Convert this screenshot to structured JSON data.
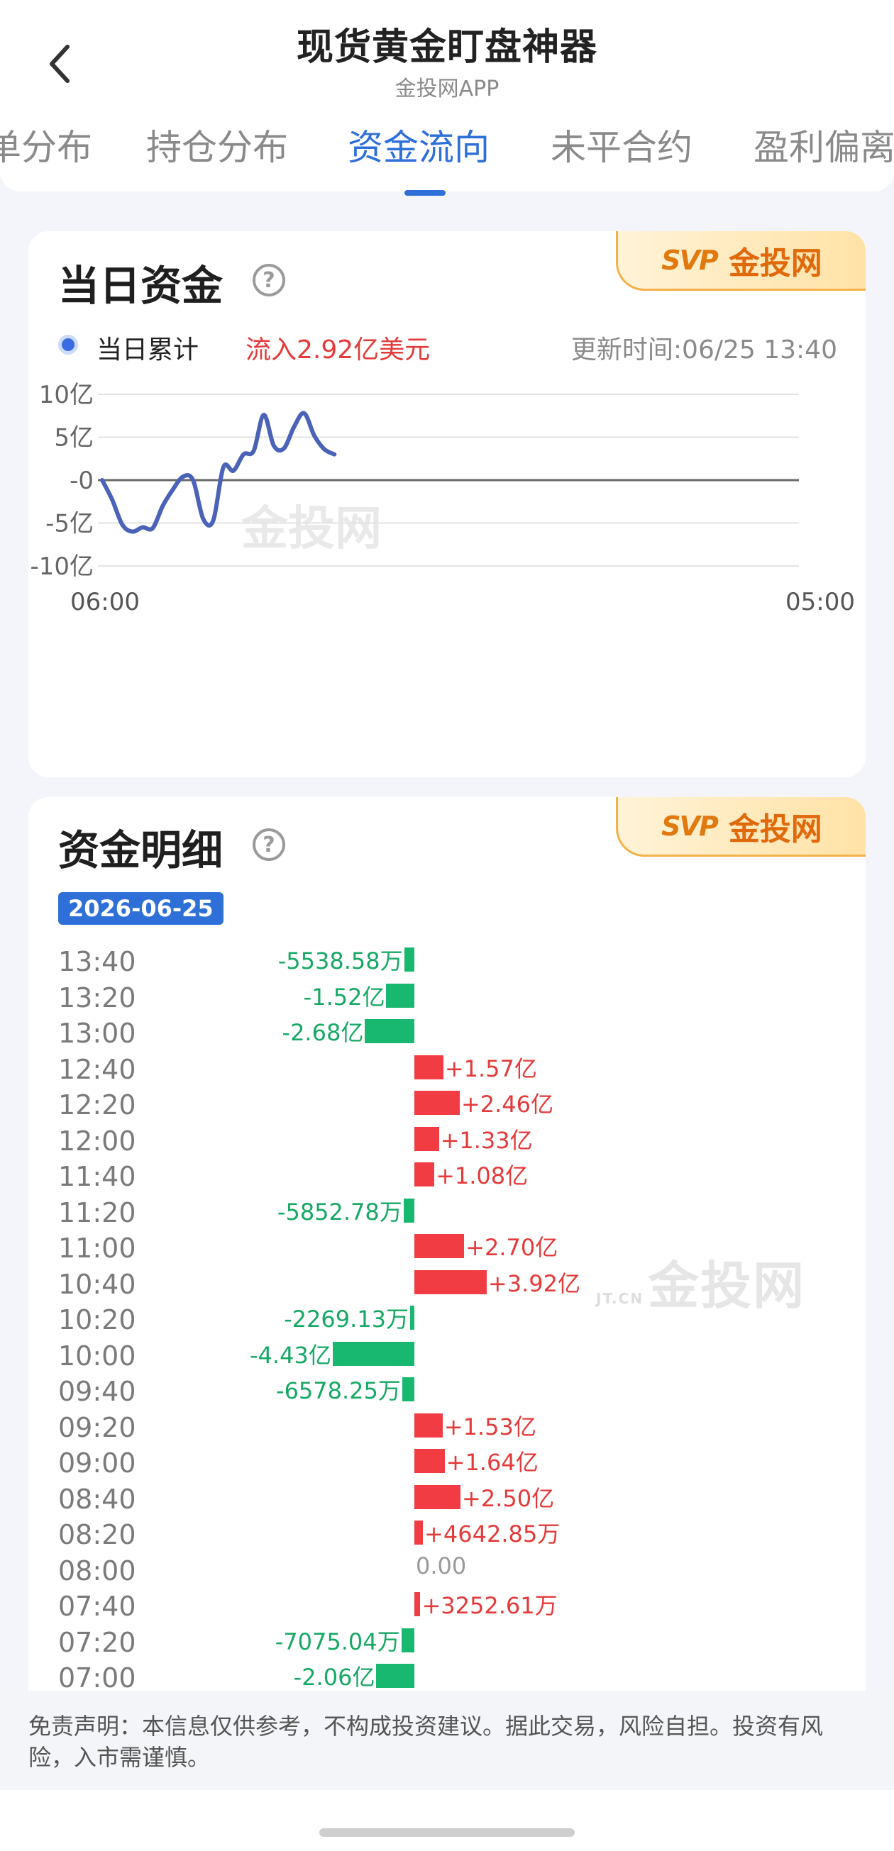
{
  "header": {
    "title": "现货黄金盯盘神器",
    "subtitle": "金投网APP",
    "tabs": [
      {
        "label": "单分布",
        "active": false
      },
      {
        "label": "持仓分布",
        "active": false
      },
      {
        "label": "资金流向",
        "active": true
      },
      {
        "label": "未平合约",
        "active": false
      },
      {
        "label": "盈利偏离",
        "active": false
      }
    ]
  },
  "brand": {
    "logo": "SVP",
    "name": "金投网"
  },
  "daily": {
    "title": "当日资金",
    "legend_label": "当日累计",
    "inflow": "流入2.92亿美元",
    "update_time": "更新时间:06/25 13:40",
    "watermark": "金投网"
  },
  "chart_data": {
    "type": "line",
    "title": "",
    "xlabel": "",
    "ylabel": "",
    "x_range": [
      "06:00",
      "05:00"
    ],
    "x_tick_labels": [
      "06:00",
      "05:00"
    ],
    "y_tick_labels": [
      "10亿",
      "5亿",
      "-0",
      "-5亿",
      "-10亿"
    ],
    "ylim": [
      -10,
      10
    ],
    "y_unit": "亿",
    "grid": true,
    "color": "#4a62b8",
    "x": [
      "06:00",
      "06:20",
      "06:40",
      "07:00",
      "07:20",
      "07:40",
      "08:00",
      "08:20",
      "08:40",
      "09:00",
      "09:20",
      "09:40",
      "10:00",
      "10:20",
      "10:40",
      "11:00",
      "11:20",
      "11:40",
      "12:00",
      "12:20",
      "12:40",
      "13:00",
      "13:20",
      "13:40"
    ],
    "values": [
      0,
      -2.3,
      -5.2,
      -6.0,
      -5.5,
      -5.6,
      -3.0,
      -1.1,
      0.4,
      0.0,
      -4.5,
      -4.7,
      1.5,
      1.1,
      3.0,
      3.4,
      7.6,
      4.0,
      3.7,
      6.2,
      7.8,
      5.2,
      3.6,
      3.0
    ]
  },
  "detail": {
    "title": "资金明细",
    "date": "2026-06-25",
    "watermark": "金投网",
    "watermark_small": "JT.CN",
    "rows": [
      {
        "time": "13:40",
        "label": "-5538.58万",
        "value": -0.5539
      },
      {
        "time": "13:20",
        "label": "-1.52亿",
        "value": -1.52
      },
      {
        "time": "13:00",
        "label": "-2.68亿",
        "value": -2.68
      },
      {
        "time": "12:40",
        "label": "+1.57亿",
        "value": 1.57
      },
      {
        "time": "12:20",
        "label": "+2.46亿",
        "value": 2.46
      },
      {
        "time": "12:00",
        "label": "+1.33亿",
        "value": 1.33
      },
      {
        "time": "11:40",
        "label": "+1.08亿",
        "value": 1.08
      },
      {
        "time": "11:20",
        "label": "-5852.78万",
        "value": -0.5853
      },
      {
        "time": "11:00",
        "label": "+2.70亿",
        "value": 2.7
      },
      {
        "time": "10:40",
        "label": "+3.92亿",
        "value": 3.92
      },
      {
        "time": "10:20",
        "label": "-2269.13万",
        "value": -0.2269
      },
      {
        "time": "10:00",
        "label": "-4.43亿",
        "value": -4.43
      },
      {
        "time": "09:40",
        "label": "-6578.25万",
        "value": -0.6578
      },
      {
        "time": "09:20",
        "label": "+1.53亿",
        "value": 1.53
      },
      {
        "time": "09:00",
        "label": "+1.64亿",
        "value": 1.64
      },
      {
        "time": "08:40",
        "label": "+2.50亿",
        "value": 2.5
      },
      {
        "time": "08:20",
        "label": "+4642.85万",
        "value": 0.4643
      },
      {
        "time": "08:00",
        "label": "0.00",
        "value": 0
      },
      {
        "time": "07:40",
        "label": "+3252.61万",
        "value": 0.3253
      },
      {
        "time": "07:20",
        "label": "-7075.04万",
        "value": -0.7075
      },
      {
        "time": "07:00",
        "label": "-2.06亿",
        "value": -2.06
      }
    ]
  },
  "disclaimer": "免责声明：本信息仅供参考，不构成投资建议。据此交易，风险自担。投资有风险，入市需谨慎。",
  "colors": {
    "accent": "#2f6fd8",
    "positive": "#f23c44",
    "negative": "#19b870",
    "line": "#4a62b8"
  },
  "icons": {
    "back": "chevron-left-icon",
    "help": "question-circle-icon"
  }
}
